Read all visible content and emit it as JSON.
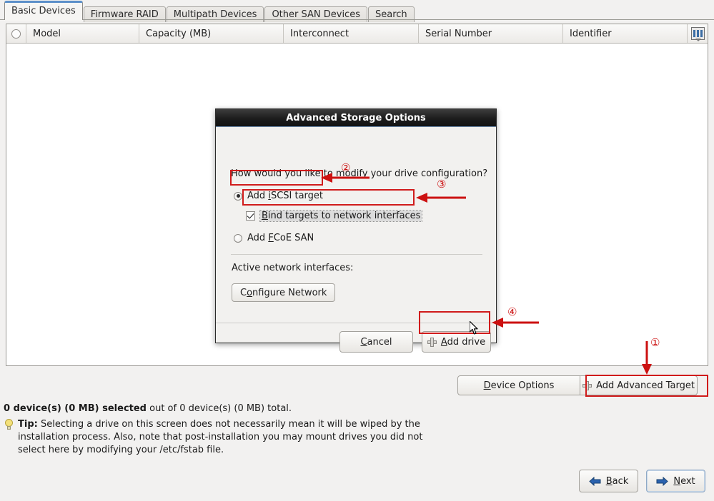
{
  "tabs": [
    {
      "label": "Basic Devices",
      "active": true
    },
    {
      "label": "Firmware RAID",
      "active": false
    },
    {
      "label": "Multipath Devices",
      "active": false
    },
    {
      "label": "Other SAN Devices",
      "active": false
    },
    {
      "label": "Search",
      "active": false
    }
  ],
  "table": {
    "columns": [
      "Model",
      "Capacity (MB)",
      "Interconnect",
      "Serial Number",
      "Identifier"
    ],
    "rows": [],
    "select_all_icon": "radio-unselected-icon",
    "column_chooser_icon": "column-chooser-icon"
  },
  "actions": {
    "device_options_label": "Device Options",
    "device_options_mnemonic": "D",
    "add_advanced_target_label": "Add Advanced Target",
    "add_advanced_target_icon": "plus-icon"
  },
  "status": {
    "selected_bold": "0 device(s) (0 MB) selected",
    "rest": " out of 0 device(s) (0 MB) total."
  },
  "tip": {
    "icon": "lightbulb-icon",
    "label": "Tip:",
    "text": " Selecting a drive on this screen does not necessarily mean it will be wiped by the installation process.  Also, note that post-installation you may mount drives you did not select here by modifying your /etc/fstab file."
  },
  "nav": {
    "back_label": "Back",
    "back_icon": "arrow-left-icon",
    "next_label": "Next",
    "next_icon": "arrow-right-icon"
  },
  "dialog": {
    "title": "Advanced Storage Options",
    "question": "How would you like to modify your drive configuration?",
    "options": [
      {
        "label": "Add iSCSI target",
        "type": "radio",
        "checked": true
      },
      {
        "label": "Bind targets to network interfaces",
        "type": "checkbox",
        "checked": true
      },
      {
        "label": "Add FCoE SAN",
        "type": "radio",
        "checked": false
      }
    ],
    "interfaces_label": "Active network interfaces:",
    "configure_network_label": "Configure Network",
    "cancel_label": "Cancel",
    "add_drive_label": "Add drive",
    "add_drive_icon": "plus-icon"
  },
  "annotations": {
    "marker_1": "①",
    "marker_2": "②",
    "marker_3": "③",
    "marker_4": "④",
    "color": "#cc1111"
  }
}
